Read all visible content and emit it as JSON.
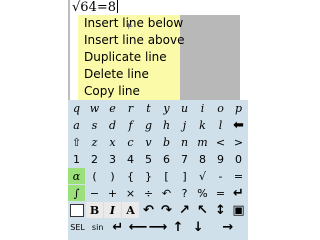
{
  "editor": {
    "expression_prefix": "√",
    "expression_radicand": "64",
    "expression_rest": "=8"
  },
  "context_menu": {
    "items": [
      {
        "label": "Insert line below"
      },
      {
        "label": "Insert line above"
      },
      {
        "label": "Duplicate line"
      },
      {
        "label": "Delete line"
      },
      {
        "label": "Copy line"
      }
    ]
  },
  "keyboard": {
    "row1": [
      "q",
      "w",
      "e",
      "r",
      "t",
      "y",
      "u",
      "i",
      "o",
      "p"
    ],
    "row2": [
      "a",
      "s",
      "d",
      "f",
      "g",
      "h",
      "j",
      "k",
      "l",
      "⬅"
    ],
    "row3": [
      "⇧",
      "z",
      "x",
      "c",
      "v",
      "b",
      "n",
      "m",
      "<",
      ">"
    ],
    "row4": [
      "1",
      "2",
      "3",
      "4",
      "5",
      "6",
      "7",
      "8",
      "9",
      "0"
    ],
    "row5": [
      "α",
      "(",
      ")",
      "{",
      "}",
      "[",
      "]",
      "√",
      "-",
      "="
    ],
    "row6": [
      "∫",
      "−",
      "+",
      "×",
      "÷",
      "↶",
      "?",
      "%",
      "=",
      "↵"
    ],
    "row7": [
      "□",
      "B",
      "I",
      "A",
      "↶",
      "↷",
      "↗",
      "↖",
      "↕",
      "▣"
    ],
    "row8": [
      "SEL",
      "sin",
      "↵",
      "⟵",
      "⟶",
      "↑",
      "↓",
      "→"
    ]
  }
}
